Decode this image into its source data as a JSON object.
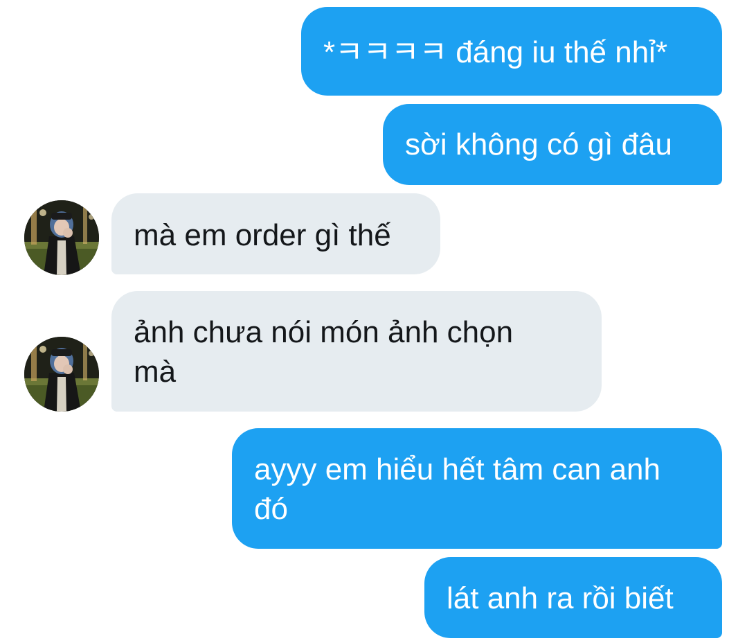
{
  "messages": [
    {
      "direction": "outgoing",
      "text": "*ㅋㅋㅋㅋ đáng iu thế nhỉ*"
    },
    {
      "direction": "outgoing",
      "text": "sời không có gì đâu"
    },
    {
      "direction": "incoming",
      "text": "mà em order gì thế",
      "avatar_icon": "user-avatar-photo"
    },
    {
      "direction": "incoming",
      "lines": [
        "ảnh chưa nói món ảnh chọn",
        "mà"
      ],
      "avatar_icon": "user-avatar-photo"
    },
    {
      "direction": "outgoing",
      "lines": [
        "ayyy em hiểu hết tâm can anh",
        "đó"
      ]
    },
    {
      "direction": "outgoing",
      "text": "lát anh ra rồi biết"
    }
  ],
  "colors": {
    "outgoing_bubble": "#1da1f2",
    "incoming_bubble": "#e6ecf0",
    "outgoing_text": "#ffffff",
    "incoming_text": "#14171a"
  }
}
